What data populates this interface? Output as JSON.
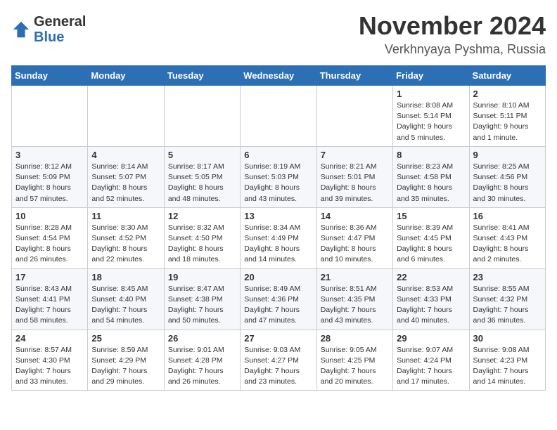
{
  "logo": {
    "general": "General",
    "blue": "Blue"
  },
  "header": {
    "month": "November 2024",
    "location": "Verkhnyaya Pyshma, Russia"
  },
  "weekdays": [
    "Sunday",
    "Monday",
    "Tuesday",
    "Wednesday",
    "Thursday",
    "Friday",
    "Saturday"
  ],
  "weeks": [
    [
      {
        "day": "",
        "info": ""
      },
      {
        "day": "",
        "info": ""
      },
      {
        "day": "",
        "info": ""
      },
      {
        "day": "",
        "info": ""
      },
      {
        "day": "",
        "info": ""
      },
      {
        "day": "1",
        "info": "Sunrise: 8:08 AM\nSunset: 5:14 PM\nDaylight: 9 hours\nand 5 minutes."
      },
      {
        "day": "2",
        "info": "Sunrise: 8:10 AM\nSunset: 5:11 PM\nDaylight: 9 hours\nand 1 minute."
      }
    ],
    [
      {
        "day": "3",
        "info": "Sunrise: 8:12 AM\nSunset: 5:09 PM\nDaylight: 8 hours\nand 57 minutes."
      },
      {
        "day": "4",
        "info": "Sunrise: 8:14 AM\nSunset: 5:07 PM\nDaylight: 8 hours\nand 52 minutes."
      },
      {
        "day": "5",
        "info": "Sunrise: 8:17 AM\nSunset: 5:05 PM\nDaylight: 8 hours\nand 48 minutes."
      },
      {
        "day": "6",
        "info": "Sunrise: 8:19 AM\nSunset: 5:03 PM\nDaylight: 8 hours\nand 43 minutes."
      },
      {
        "day": "7",
        "info": "Sunrise: 8:21 AM\nSunset: 5:01 PM\nDaylight: 8 hours\nand 39 minutes."
      },
      {
        "day": "8",
        "info": "Sunrise: 8:23 AM\nSunset: 4:58 PM\nDaylight: 8 hours\nand 35 minutes."
      },
      {
        "day": "9",
        "info": "Sunrise: 8:25 AM\nSunset: 4:56 PM\nDaylight: 8 hours\nand 30 minutes."
      }
    ],
    [
      {
        "day": "10",
        "info": "Sunrise: 8:28 AM\nSunset: 4:54 PM\nDaylight: 8 hours\nand 26 minutes."
      },
      {
        "day": "11",
        "info": "Sunrise: 8:30 AM\nSunset: 4:52 PM\nDaylight: 8 hours\nand 22 minutes."
      },
      {
        "day": "12",
        "info": "Sunrise: 8:32 AM\nSunset: 4:50 PM\nDaylight: 8 hours\nand 18 minutes."
      },
      {
        "day": "13",
        "info": "Sunrise: 8:34 AM\nSunset: 4:49 PM\nDaylight: 8 hours\nand 14 minutes."
      },
      {
        "day": "14",
        "info": "Sunrise: 8:36 AM\nSunset: 4:47 PM\nDaylight: 8 hours\nand 10 minutes."
      },
      {
        "day": "15",
        "info": "Sunrise: 8:39 AM\nSunset: 4:45 PM\nDaylight: 8 hours\nand 6 minutes."
      },
      {
        "day": "16",
        "info": "Sunrise: 8:41 AM\nSunset: 4:43 PM\nDaylight: 8 hours\nand 2 minutes."
      }
    ],
    [
      {
        "day": "17",
        "info": "Sunrise: 8:43 AM\nSunset: 4:41 PM\nDaylight: 7 hours\nand 58 minutes."
      },
      {
        "day": "18",
        "info": "Sunrise: 8:45 AM\nSunset: 4:40 PM\nDaylight: 7 hours\nand 54 minutes."
      },
      {
        "day": "19",
        "info": "Sunrise: 8:47 AM\nSunset: 4:38 PM\nDaylight: 7 hours\nand 50 minutes."
      },
      {
        "day": "20",
        "info": "Sunrise: 8:49 AM\nSunset: 4:36 PM\nDaylight: 7 hours\nand 47 minutes."
      },
      {
        "day": "21",
        "info": "Sunrise: 8:51 AM\nSunset: 4:35 PM\nDaylight: 7 hours\nand 43 minutes."
      },
      {
        "day": "22",
        "info": "Sunrise: 8:53 AM\nSunset: 4:33 PM\nDaylight: 7 hours\nand 40 minutes."
      },
      {
        "day": "23",
        "info": "Sunrise: 8:55 AM\nSunset: 4:32 PM\nDaylight: 7 hours\nand 36 minutes."
      }
    ],
    [
      {
        "day": "24",
        "info": "Sunrise: 8:57 AM\nSunset: 4:30 PM\nDaylight: 7 hours\nand 33 minutes."
      },
      {
        "day": "25",
        "info": "Sunrise: 8:59 AM\nSunset: 4:29 PM\nDaylight: 7 hours\nand 29 minutes."
      },
      {
        "day": "26",
        "info": "Sunrise: 9:01 AM\nSunset: 4:28 PM\nDaylight: 7 hours\nand 26 minutes."
      },
      {
        "day": "27",
        "info": "Sunrise: 9:03 AM\nSunset: 4:27 PM\nDaylight: 7 hours\nand 23 minutes."
      },
      {
        "day": "28",
        "info": "Sunrise: 9:05 AM\nSunset: 4:25 PM\nDaylight: 7 hours\nand 20 minutes."
      },
      {
        "day": "29",
        "info": "Sunrise: 9:07 AM\nSunset: 4:24 PM\nDaylight: 7 hours\nand 17 minutes."
      },
      {
        "day": "30",
        "info": "Sunrise: 9:08 AM\nSunset: 4:23 PM\nDaylight: 7 hours\nand 14 minutes."
      }
    ]
  ]
}
